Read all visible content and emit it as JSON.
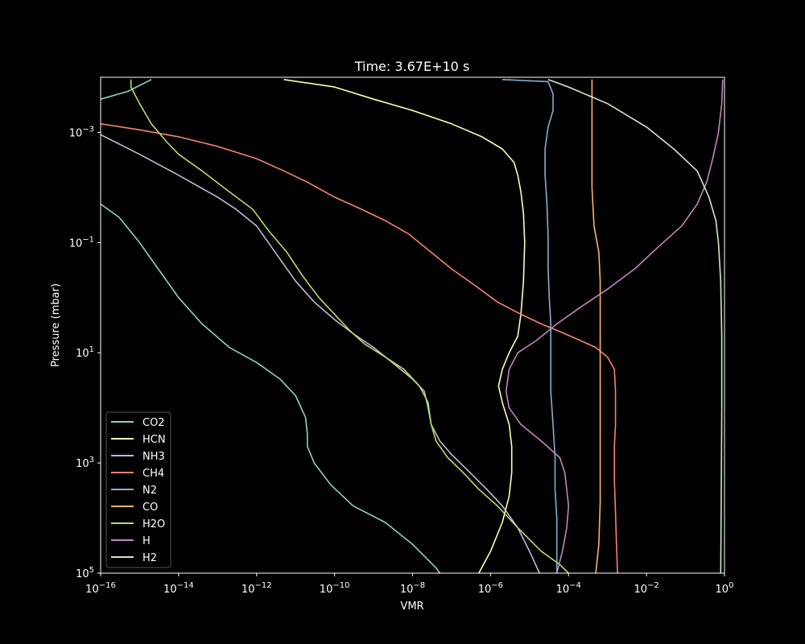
{
  "chart_data": {
    "type": "line",
    "title": "Time: 3.67E+10 s",
    "xlabel": "VMR",
    "ylabel": "Pressure (mbar)",
    "xscale": "log",
    "yscale": "log",
    "y_inverted": true,
    "xlim": [
      1e-16,
      1
    ],
    "ylim": [
      100000,
      0.0001
    ],
    "x_ticks": [
      {
        "value": 1e-16,
        "base": "10",
        "exp": "−16"
      },
      {
        "value": 1e-14,
        "base": "10",
        "exp": "−14"
      },
      {
        "value": 1e-12,
        "base": "10",
        "exp": "−12"
      },
      {
        "value": 1e-10,
        "base": "10",
        "exp": "−10"
      },
      {
        "value": 1e-08,
        "base": "10",
        "exp": "−8"
      },
      {
        "value": 1e-06,
        "base": "10",
        "exp": "−6"
      },
      {
        "value": 0.0001,
        "base": "10",
        "exp": "−4"
      },
      {
        "value": 0.01,
        "base": "10",
        "exp": "−2"
      },
      {
        "value": 1,
        "base": "10",
        "exp": "0"
      }
    ],
    "y_ticks": [
      {
        "value": 0.001,
        "base": "10",
        "exp": "−3"
      },
      {
        "value": 0.1,
        "base": "10",
        "exp": "−1"
      },
      {
        "value": 10,
        "base": "10",
        "exp": "1"
      },
      {
        "value": 1000,
        "base": "10",
        "exp": "3"
      },
      {
        "value": 100000,
        "base": "10",
        "exp": "5"
      }
    ],
    "grid": false,
    "legend_position": "lower-left",
    "background": "#000000",
    "foreground": "#ffffff",
    "series": [
      {
        "name": "CO2",
        "color": "#8dd3c7",
        "points": [
          [
            2e-15,
            0.00011
          ],
          [
            5e-16,
            0.00018
          ],
          [
            1e-16,
            0.00025
          ],
          [
            1e-16,
            0.00025
          ]
        ],
        "points2": [
          [
            1e-16,
            0.02
          ],
          [
            3e-16,
            0.035
          ],
          [
            1e-15,
            0.1
          ],
          [
            3e-15,
            0.3
          ],
          [
            1e-14,
            1
          ],
          [
            4e-14,
            3
          ],
          [
            2e-13,
            8
          ],
          [
            1e-12,
            15
          ],
          [
            4e-12,
            30
          ],
          [
            1e-11,
            60
          ],
          [
            1.8e-11,
            150
          ],
          [
            2e-11,
            300
          ],
          [
            2e-11,
            500
          ],
          [
            3e-11,
            1000
          ],
          [
            8e-11,
            2500
          ],
          [
            3e-10,
            6000
          ],
          [
            2e-09,
            12000
          ],
          [
            1e-08,
            30000
          ],
          [
            4e-08,
            80000
          ],
          [
            5e-08,
            100000
          ]
        ]
      },
      {
        "name": "HCN",
        "color": "#ffffb3",
        "points": [
          [
            5e-12,
            0.00011
          ],
          [
            1e-10,
            0.00015
          ],
          [
            1e-09,
            0.00025
          ],
          [
            1e-08,
            0.0004
          ],
          [
            1e-07,
            0.0007
          ],
          [
            6e-07,
            0.0012
          ],
          [
            2e-06,
            0.002
          ],
          [
            4e-06,
            0.0035
          ],
          [
            5e-06,
            0.006
          ],
          [
            6e-06,
            0.012
          ],
          [
            7e-06,
            0.03
          ],
          [
            7.5e-06,
            0.1
          ],
          [
            7e-06,
            0.5
          ],
          [
            6e-06,
            2
          ],
          [
            5e-06,
            5
          ],
          [
            3e-06,
            10
          ],
          [
            2e-06,
            20
          ],
          [
            1.6e-06,
            40
          ],
          [
            2e-06,
            80
          ],
          [
            3e-06,
            200
          ],
          [
            3.5e-06,
            500
          ],
          [
            3.5e-06,
            1500
          ],
          [
            3e-06,
            4000
          ],
          [
            2e-06,
            12000
          ],
          [
            1e-06,
            40000
          ],
          [
            5e-07,
            100000
          ]
        ]
      },
      {
        "name": "NH3",
        "color": "#bebada",
        "points": [
          [
            1e-16,
            0.0011
          ],
          [
            1e-15,
            0.0025
          ],
          [
            1e-14,
            0.006
          ],
          [
            1e-13,
            0.015
          ],
          [
            3e-13,
            0.025
          ],
          [
            1e-12,
            0.05
          ],
          [
            3e-12,
            0.15
          ],
          [
            1e-11,
            0.5
          ],
          [
            3e-11,
            1.2
          ],
          [
            1e-10,
            2.5
          ],
          [
            3e-10,
            4.5
          ],
          [
            1e-09,
            8
          ],
          [
            3e-09,
            15
          ],
          [
            1e-08,
            30
          ],
          [
            2e-08,
            50
          ],
          [
            2.5e-08,
            100
          ],
          [
            3e-08,
            200
          ],
          [
            5e-08,
            400
          ],
          [
            1e-07,
            700
          ],
          [
            3e-07,
            1500
          ],
          [
            8e-07,
            3000
          ],
          [
            2e-06,
            6000
          ],
          [
            5e-06,
            15000
          ],
          [
            1e-05,
            40000
          ],
          [
            1.8e-05,
            100000
          ]
        ]
      },
      {
        "name": "CH4",
        "color": "#fb8072",
        "points": [
          [
            1e-16,
            0.0007
          ],
          [
            1e-15,
            0.0009
          ],
          [
            1e-14,
            0.0012
          ],
          [
            1e-13,
            0.0018
          ],
          [
            1e-12,
            0.003
          ],
          [
            5e-12,
            0.005
          ],
          [
            2e-11,
            0.008
          ],
          [
            1e-10,
            0.015
          ],
          [
            5e-10,
            0.025
          ],
          [
            2e-09,
            0.04
          ],
          [
            8e-09,
            0.07
          ],
          [
            3e-08,
            0.15
          ],
          [
            1e-07,
            0.3
          ],
          [
            4e-07,
            0.6
          ],
          [
            1.5e-06,
            1.2
          ],
          [
            6e-06,
            2
          ],
          [
            2e-05,
            3
          ],
          [
            8e-05,
            4.5
          ],
          [
            0.0002,
            6
          ],
          [
            0.0005,
            8
          ],
          [
            0.001,
            12
          ],
          [
            0.0015,
            20
          ],
          [
            0.0016,
            50
          ],
          [
            0.0016,
            200
          ],
          [
            0.0015,
            500
          ],
          [
            0.0015,
            2000
          ],
          [
            0.0016,
            8000
          ],
          [
            0.0017,
            30000
          ],
          [
            0.0018,
            100000
          ]
        ]
      },
      {
        "name": "N2",
        "color": "#80b1d3",
        "points": [
          [
            2e-06,
            0.00011
          ],
          [
            3e-05,
            0.00012
          ],
          [
            4e-05,
            0.0002
          ],
          [
            4e-05,
            0.0004
          ],
          [
            3e-05,
            0.0008
          ],
          [
            2.5e-05,
            0.002
          ],
          [
            2.5e-05,
            0.006
          ],
          [
            2.8e-05,
            0.02
          ],
          [
            3e-05,
            0.08
          ],
          [
            3e-05,
            0.3
          ],
          [
            3.2e-05,
            1
          ],
          [
            3.5e-05,
            3
          ],
          [
            3.5e-05,
            10
          ],
          [
            3.5e-05,
            50
          ],
          [
            4e-05,
            200
          ],
          [
            4.5e-05,
            800
          ],
          [
            4.5e-05,
            3000
          ],
          [
            5e-05,
            10000
          ],
          [
            5e-05,
            30000
          ],
          [
            5e-05,
            100000
          ]
        ]
      },
      {
        "name": "CO",
        "color": "#fdb462",
        "points": [
          [
            0.0004,
            0.00011
          ],
          [
            0.0004,
            0.001
          ],
          [
            0.0004,
            0.01
          ],
          [
            0.00045,
            0.05
          ],
          [
            0.0006,
            0.15
          ],
          [
            0.00065,
            0.5
          ],
          [
            0.00065,
            5
          ],
          [
            0.00065,
            50
          ],
          [
            0.00065,
            500
          ],
          [
            0.00065,
            5000
          ],
          [
            0.0006,
            30000
          ],
          [
            0.0005,
            100000
          ]
        ]
      },
      {
        "name": "H2O",
        "color": "#b3de69",
        "points": [
          [
            6e-16,
            0.00011
          ],
          [
            6e-16,
            0.00015
          ],
          [
            1e-15,
            0.0003
          ],
          [
            2e-15,
            0.0007
          ],
          [
            5e-15,
            0.0015
          ],
          [
            1e-14,
            0.0025
          ],
          [
            4e-14,
            0.005
          ],
          [
            2e-13,
            0.012
          ],
          [
            8e-13,
            0.025
          ],
          [
            2e-12,
            0.06
          ],
          [
            6e-12,
            0.15
          ],
          [
            1.5e-11,
            0.4
          ],
          [
            4e-11,
            1
          ],
          [
            1e-10,
            2
          ],
          [
            2.5e-10,
            4
          ],
          [
            6e-10,
            7
          ],
          [
            2e-09,
            12
          ],
          [
            6e-09,
            20
          ],
          [
            1.5e-08,
            40
          ],
          [
            2.5e-08,
            80
          ],
          [
            3e-08,
            200
          ],
          [
            4e-08,
            400
          ],
          [
            8e-08,
            800
          ],
          [
            2e-07,
            1500
          ],
          [
            5e-07,
            3000
          ],
          [
            1.5e-06,
            6000
          ],
          [
            5e-06,
            15000
          ],
          [
            2e-05,
            40000
          ],
          [
            6e-05,
            70000
          ],
          [
            0.0001,
            100000
          ]
        ]
      },
      {
        "name": "H",
        "color": "#fccde5",
        "points": [
          [
            0.9,
            0.00011
          ],
          [
            0.85,
            0.0003
          ],
          [
            0.7,
            0.001
          ],
          [
            0.5,
            0.003
          ],
          [
            0.35,
            0.008
          ],
          [
            0.2,
            0.02
          ],
          [
            0.08,
            0.05
          ],
          [
            0.02,
            0.12
          ],
          [
            0.005,
            0.3
          ],
          [
            0.001,
            0.7
          ],
          [
            0.0002,
            1.5
          ],
          [
            5e-05,
            3
          ],
          [
            1.5e-05,
            6
          ],
          [
            5e-06,
            10
          ],
          [
            3e-06,
            20
          ],
          [
            2.5e-06,
            50
          ],
          [
            3e-06,
            100
          ],
          [
            6e-06,
            200
          ],
          [
            2e-05,
            400
          ],
          [
            6e-05,
            800
          ],
          [
            8e-05,
            1500
          ],
          [
            9e-05,
            3000
          ],
          [
            0.0001,
            6000
          ],
          [
            9e-05,
            15000
          ],
          [
            7e-05,
            40000
          ],
          [
            5e-05,
            100000
          ]
        ],
        "color_hex": "#c186c0"
      },
      {
        "name": "H2",
        "color": "#ccebc5",
        "points": [
          [
            3e-05,
            0.00011
          ],
          [
            0.0001,
            0.00015
          ],
          [
            0.001,
            0.0003
          ],
          [
            0.01,
            0.0008
          ],
          [
            0.05,
            0.002
          ],
          [
            0.2,
            0.005
          ],
          [
            0.4,
            0.015
          ],
          [
            0.6,
            0.04
          ],
          [
            0.7,
            0.1
          ],
          [
            0.8,
            0.5
          ],
          [
            0.85,
            5
          ],
          [
            0.85,
            100
          ],
          [
            0.82,
            10000
          ],
          [
            0.8,
            100000
          ]
        ]
      }
    ]
  }
}
